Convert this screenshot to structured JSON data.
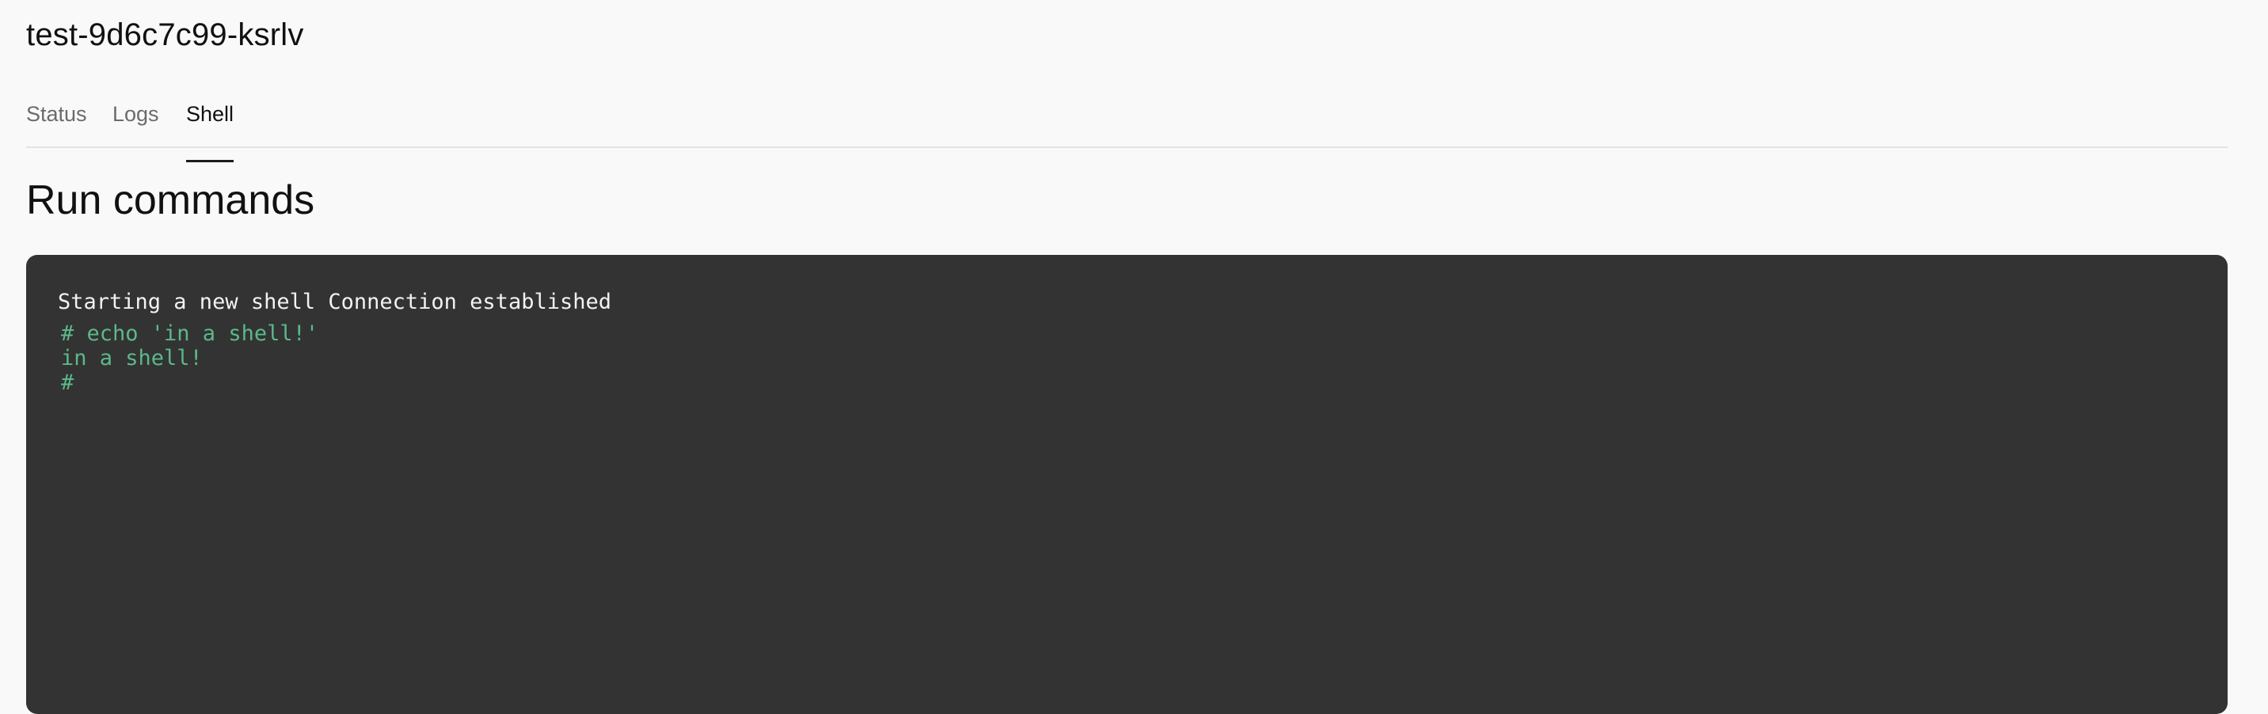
{
  "pod": {
    "name": "test-9d6c7c99-ksrlv"
  },
  "tabs": [
    {
      "label": "Status",
      "active": false
    },
    {
      "label": "Logs",
      "active": false
    },
    {
      "label": "Shell",
      "active": true
    }
  ],
  "section": {
    "title": "Run commands"
  },
  "terminal": {
    "status_message": "Starting a new shell Connection established",
    "lines": [
      "# echo 'in a shell!'",
      "in a shell!",
      "#"
    ],
    "colors": {
      "background": "#333333",
      "status_text": "#f2f2f2",
      "output_text": "#5cb88a"
    }
  }
}
